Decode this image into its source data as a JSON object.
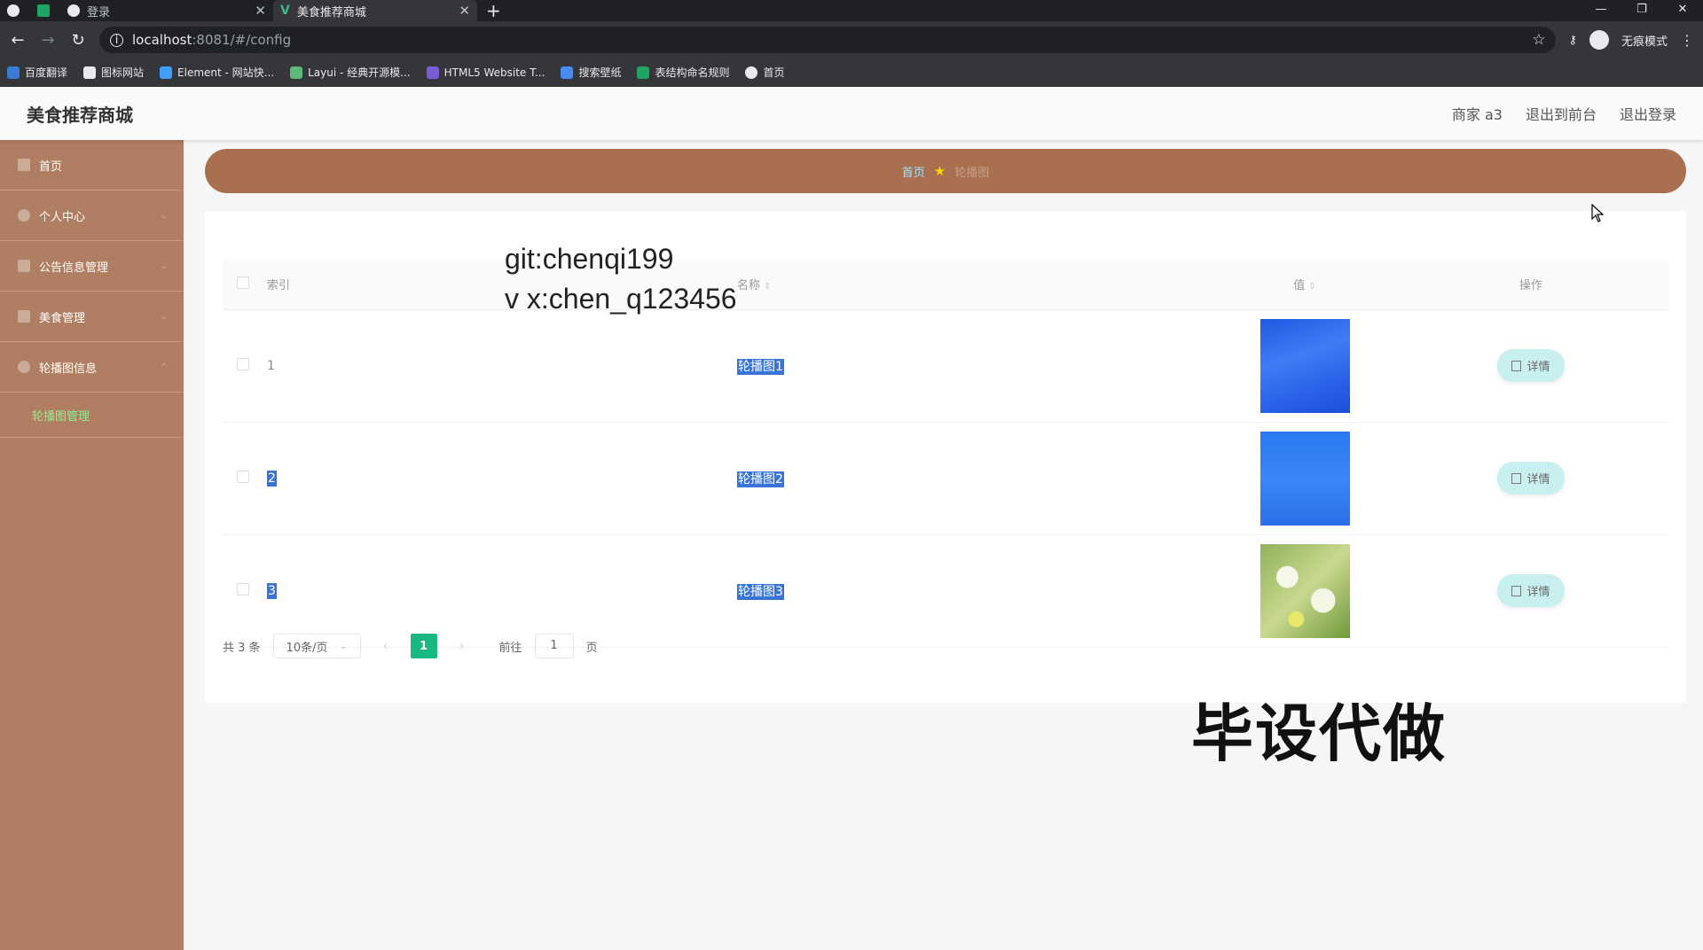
{
  "browser": {
    "tabs": [
      {
        "label": "",
        "icon": "globe-icon"
      },
      {
        "label": "",
        "icon": "sheet-icon"
      },
      {
        "label": "登录",
        "icon": "globe-icon"
      },
      {
        "label": "美食推荐商城",
        "icon": "vue-icon"
      }
    ],
    "url_host": "localhost",
    "url_path": ":8081/#/config",
    "incognito_label": "无痕模式",
    "bookmarks": [
      "百度翻译",
      "图标网站",
      "Element - 网站快...",
      "Layui - 经典开源模...",
      "HTML5 Website T...",
      "搜索壁纸",
      "表结构命名规则",
      "首页"
    ]
  },
  "header": {
    "title": "美食推荐商城",
    "user": "商家 a3",
    "back_to_front": "退出到前台",
    "logout": "退出登录"
  },
  "sidebar": {
    "items": [
      {
        "label": "首页"
      },
      {
        "label": "个人中心"
      },
      {
        "label": "公告信息管理"
      },
      {
        "label": "美食管理"
      },
      {
        "label": "轮播图信息"
      }
    ],
    "subitem": "轮播图管理"
  },
  "breadcrumb": {
    "home": "首页",
    "current": "轮播图"
  },
  "watermark": {
    "line1": "git:chenqi199",
    "line2": "v x:chen_q123456",
    "corner": "毕设代做"
  },
  "table": {
    "headers": {
      "index": "索引",
      "name": "名称",
      "value": "值",
      "op": "操作"
    },
    "rows": [
      {
        "index": "1",
        "name": "轮播图1",
        "detail": "详情"
      },
      {
        "index": "2",
        "name": "轮播图2",
        "detail": "详情"
      },
      {
        "index": "3",
        "name": "轮播图3",
        "detail": "详情"
      }
    ]
  },
  "pagination": {
    "total": "共 3 条",
    "page_size": "10条/页",
    "current_page": "1",
    "goto_label": "前往",
    "goto_value": "1",
    "page_suffix": "页"
  },
  "colors": {
    "sidebar": "#b07e63",
    "breadcrumb": "#a9704f",
    "active_page": "#18b981",
    "detail_button": "#c9f0f0"
  }
}
